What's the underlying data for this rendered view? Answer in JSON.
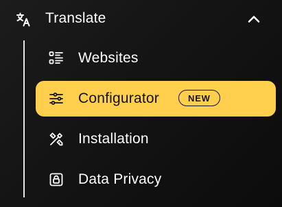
{
  "section": {
    "label": "Translate",
    "icon": "translate-icon",
    "expanded": true
  },
  "items": [
    {
      "label": "Websites",
      "icon": "list-icon",
      "active": false
    },
    {
      "label": "Configurator",
      "icon": "sliders-icon",
      "active": true,
      "badge": "NEW"
    },
    {
      "label": "Installation",
      "icon": "tools-icon",
      "active": false
    },
    {
      "label": "Data Privacy",
      "icon": "lock-icon",
      "active": false
    }
  ],
  "colors": {
    "background": "#151515",
    "active_background": "#ffcf4d",
    "active_text": "#111111",
    "text": "#ffffff"
  }
}
